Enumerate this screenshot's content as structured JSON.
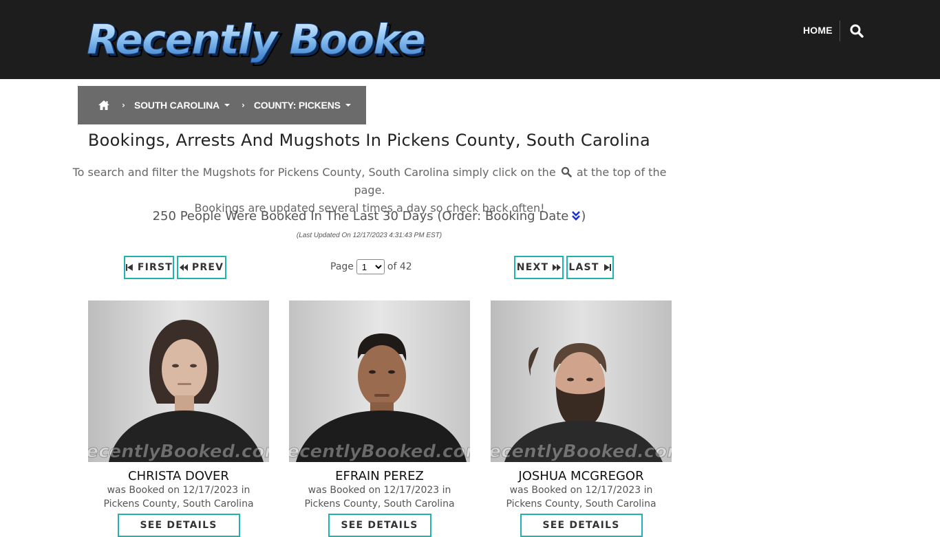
{
  "header": {
    "logo_text": "Recently Booked",
    "nav_home": "HOME",
    "accent": "#1fb3ad"
  },
  "breadcrumb": {
    "state": "SOUTH CAROLINA",
    "county": "COUNTY: PICKENS"
  },
  "main": {
    "title": "Bookings, Arrests And Mugshots In Pickens County, South Carolina",
    "intro_before": "To search and filter the Mugshots for Pickens County, South Carolina simply click on the",
    "intro_after": "at the top of the page.",
    "intro_line2": "Bookings are updated several times a day so check back often!",
    "count_text": "250 People Were Booked In The Last 30 Days (Order: Booking Date",
    "count_close": ")",
    "updated": "(Last Updated On 12/17/2023 4:31:43 PM EST)"
  },
  "pagination": {
    "first": "FIRST",
    "prev": "PREV",
    "next": "NEXT",
    "last": "LAST",
    "page_label": "Page",
    "current_page": "1",
    "of_label": "of 42"
  },
  "bookings": [
    {
      "name": "CHRISTA DOVER",
      "line1": "was Booked on 12/17/2023 in",
      "line2": "Pickens County, South Carolina",
      "button": "SEE DETAILS"
    },
    {
      "name": "EFRAIN PEREZ",
      "line1": "was Booked on 12/17/2023 in",
      "line2": "Pickens County, South Carolina",
      "button": "SEE DETAILS"
    },
    {
      "name": "JOSHUA MCGREGOR",
      "line1": "was Booked on 12/17/2023 in",
      "line2": "Pickens County, South Carolina",
      "button": "SEE DETAILS"
    }
  ],
  "watermark": "RecentlyBooked.com",
  "icons": {
    "home": "home-icon",
    "search": "search-icon",
    "sort": "double-chevron-down-icon"
  }
}
